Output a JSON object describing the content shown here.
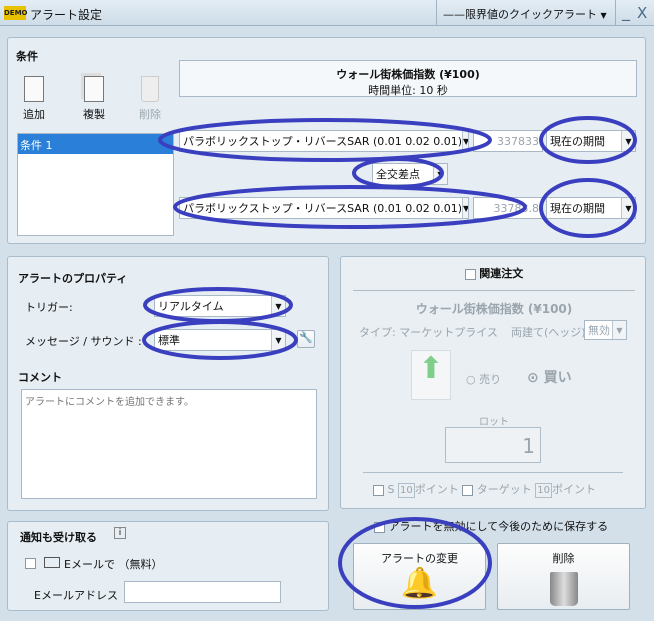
{
  "window": {
    "title": "アラート設定",
    "quick_alert": "——限界値のクイックアラート",
    "minimize": "_",
    "close": "X",
    "logo": "DEMO"
  },
  "conditions": {
    "heading": "条件",
    "add": "追加",
    "duplicate": "複製",
    "delete": "削除",
    "list": [
      "条件 1"
    ],
    "instrument": "ウォール街株価指数 (¥100)",
    "timeframe": "時間単位: 10 秒",
    "indicator1": "パラボリックストップ・リバースSAR (0.01 0.02 0.01)",
    "value1": "337833",
    "period1": "現在の期間",
    "operator": "全交差点",
    "indicator2": "パラボリックストップ・リバースSAR (0.01 0.02 0.01)",
    "value2": "33783.8",
    "period2": "現在の期間"
  },
  "properties": {
    "heading": "アラートのプロパティ",
    "trigger_label": "トリガー:",
    "trigger": "リアルタイム",
    "sound_label": "メッセージ / サウンド :",
    "sound": "標準",
    "comment_label": "コメント",
    "comment_placeholder": "アラートにコメントを追加できます。"
  },
  "notify": {
    "heading": "通知も受け取る",
    "info": "i",
    "email_check": "Eメールで （無料）",
    "email_label": "Eメールアドレス",
    "email_value": ""
  },
  "order": {
    "heading": "関連注文",
    "instrument": "ウォール街株価指数 (¥100)",
    "type": "タイプ: マーケットプライス",
    "hedge_label": "両建て(ヘッジ)",
    "hedge": "無効",
    "sell": "売り",
    "buy": "買い",
    "lot_label": "ロット",
    "lot": "1",
    "sl_label": "S",
    "sl_value": "10",
    "sl_unit": "ポイント",
    "tp_label": "ターゲット",
    "tp_value": "10",
    "tp_unit": "ポイント"
  },
  "footer": {
    "save_disabled": "アラートを無効にして今後のために保存する",
    "change": "アラートの変更",
    "delete": "削除"
  },
  "colors": {
    "annotation": "#3a3fbf",
    "selection": "#2a7fd8"
  }
}
